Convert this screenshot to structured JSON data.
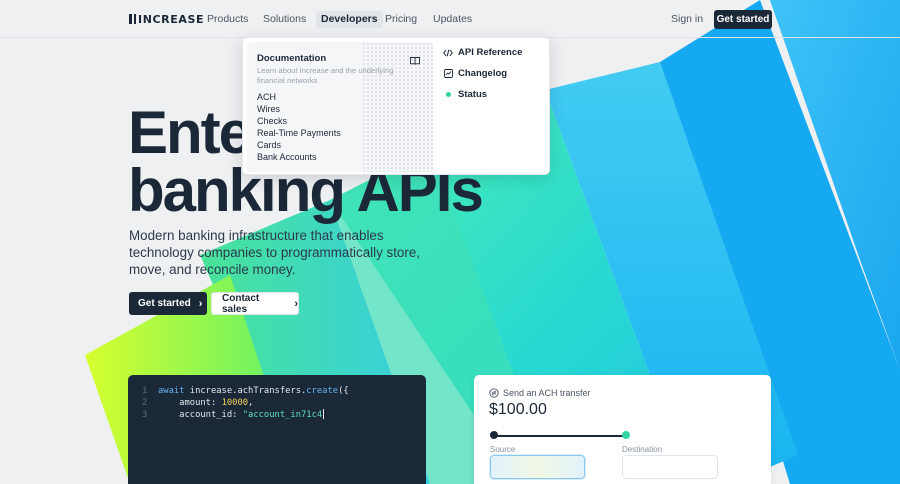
{
  "brand": {
    "logo_text": "INCREASE"
  },
  "nav": {
    "items": [
      {
        "label": "Products"
      },
      {
        "label": "Solutions"
      },
      {
        "label": "Developers"
      },
      {
        "label": "Pricing"
      },
      {
        "label": "Updates"
      }
    ],
    "sign_in": "Sign in",
    "get_started": "Get started"
  },
  "dropdown": {
    "documentation": {
      "title": "Documentation",
      "description": "Learn about Increase and the underlying financial networks",
      "links": [
        "ACH",
        "Wires",
        "Checks",
        "Real-Time Payments",
        "Cards",
        "Bank Accounts"
      ]
    },
    "right": [
      {
        "label": "API Reference",
        "icon": "code-icon"
      },
      {
        "label": "Changelog",
        "icon": "changelog-icon"
      },
      {
        "label": "Status",
        "icon": "status-dot-icon"
      }
    ]
  },
  "hero": {
    "title_line1": "Ente",
    "title_line2": "banking APIs",
    "subtitle": "Modern banking infrastructure that enables technology companies to programmatically store, move, and reconcile money.",
    "primary_cta": "Get started",
    "secondary_cta": "Contact sales"
  },
  "code": {
    "lines": [
      {
        "num": "1",
        "kw": "await",
        "obj": " increase.achTransfers.",
        "fn": "create",
        "rest": "({"
      },
      {
        "num": "2",
        "key": "    amount: ",
        "value": "10000",
        "rest": ","
      },
      {
        "num": "3",
        "key": "    account_id: ",
        "value": "\"account_in71c4"
      }
    ]
  },
  "ach": {
    "label": "Send an ACH transfer",
    "amount": "$100.00",
    "source_label": "Source",
    "destination_label": "Destination"
  },
  "colors": {
    "brand_dark": "#1b2838",
    "accent_blue": "#2fb7f5",
    "accent_green": "#31d3a1",
    "accent_lime": "#c9f53a"
  }
}
